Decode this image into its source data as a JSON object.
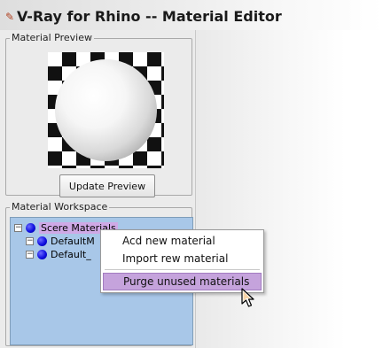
{
  "window": {
    "title": "V-Ray for Rhino -- Material Editor"
  },
  "material_preview": {
    "group_label": "Material Preview",
    "update_button_label": "Update Preview"
  },
  "material_workspace": {
    "group_label": "Material Workspace",
    "tree": [
      {
        "label": "Scere Materials",
        "expander": "−",
        "selected": true
      },
      {
        "label": "DefaultM",
        "expander": "−",
        "selected": false
      },
      {
        "label": "Default_",
        "expander": "−",
        "selected": false
      }
    ]
  },
  "context_menu": {
    "items": [
      {
        "label": "Acd new material"
      },
      {
        "label": "Import rew material"
      },
      {
        "label": "Purge unused materials",
        "hovered": true
      }
    ]
  },
  "colors": {
    "tree_background": "#a8c7e8",
    "selection_highlight": "#cfa9e6",
    "menu_hover": "#c5a3dc",
    "node_icon": "#1010e0"
  },
  "icons": {
    "title_icon": "vray-icon",
    "node_icon": "blue-sphere-icon",
    "cursor": "arrow-cursor-icon"
  }
}
